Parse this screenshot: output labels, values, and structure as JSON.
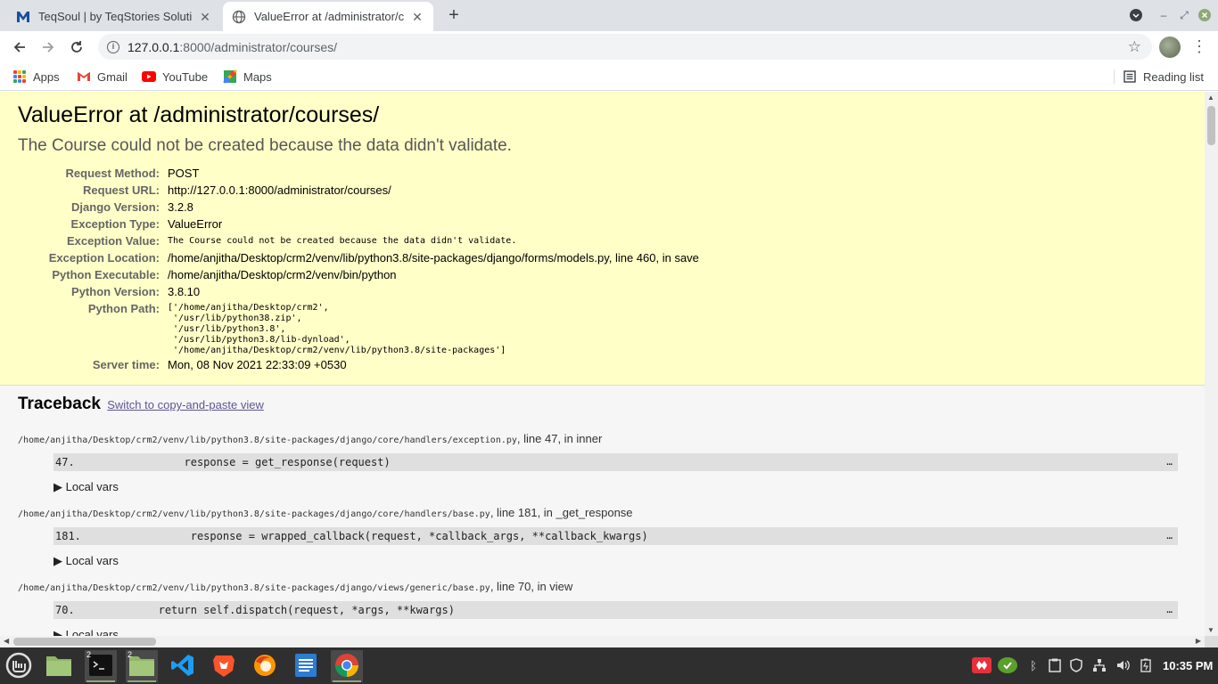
{
  "browser": {
    "tabs": [
      {
        "title": "TeqSoul | by TeqStories Soluti",
        "active": false,
        "favicon": "m-logo-icon"
      },
      {
        "title": "ValueError at /administrator/c",
        "active": true,
        "favicon": "globe-icon"
      }
    ],
    "url_host": "127.0.0.1",
    "url_path": ":8000/administrator/courses/",
    "bookmarks": [
      {
        "label": "Apps",
        "icon": "apps-grid-icon"
      },
      {
        "label": "Gmail",
        "icon": "gmail-icon"
      },
      {
        "label": "YouTube",
        "icon": "youtube-icon"
      },
      {
        "label": "Maps",
        "icon": "maps-icon"
      }
    ],
    "reading_list": "Reading list"
  },
  "error": {
    "title": "ValueError at /administrator/courses/",
    "message": "The Course could not be created because the data didn't validate.",
    "meta": [
      {
        "label": "Request Method:",
        "value": "POST"
      },
      {
        "label": "Request URL:",
        "value": "http://127.0.0.1:8000/administrator/courses/"
      },
      {
        "label": "Django Version:",
        "value": "3.2.8"
      },
      {
        "label": "Exception Type:",
        "value": "ValueError"
      },
      {
        "label": "Exception Value:",
        "value": "The Course could not be created because the data didn't validate."
      },
      {
        "label": "Exception Location:",
        "value": "/home/anjitha/Desktop/crm2/venv/lib/python3.8/site-packages/django/forms/models.py, line 460, in save"
      },
      {
        "label": "Python Executable:",
        "value": "/home/anjitha/Desktop/crm2/venv/bin/python"
      },
      {
        "label": "Python Version:",
        "value": "3.8.10"
      },
      {
        "label": "Python Path:",
        "value": "['/home/anjitha/Desktop/crm2',\n '/usr/lib/python38.zip',\n '/usr/lib/python3.8',\n '/usr/lib/python3.8/lib-dynload',\n '/home/anjitha/Desktop/crm2/venv/lib/python3.8/site-packages']"
      },
      {
        "label": "Server time:",
        "value": "Mon, 08 Nov 2021 22:33:09 +0530"
      }
    ]
  },
  "traceback": {
    "heading": "Traceback",
    "switch_link": "Switch to copy-and-paste view",
    "local_vars_label": "▶ Local vars",
    "frames": [
      {
        "file": "/home/anjitha/Desktop/crm2/venv/lib/python3.8/site-packages/django/core/handlers/exception.py",
        "where": ", line 47, in inner",
        "code": "47.                 response = get_response(request)"
      },
      {
        "file": "/home/anjitha/Desktop/crm2/venv/lib/python3.8/site-packages/django/core/handlers/base.py",
        "where": ", line 181, in _get_response",
        "code": "181.                 response = wrapped_callback(request, *callback_args, **callback_kwargs)"
      },
      {
        "file": "/home/anjitha/Desktop/crm2/venv/lib/python3.8/site-packages/django/views/generic/base.py",
        "where": ", line 70, in view",
        "code": "70.             return self.dispatch(request, *args, **kwargs)"
      }
    ],
    "ellipsis": "…"
  },
  "taskbar": {
    "badge_terminal": "2",
    "badge_files": "2",
    "clock": "10:35 PM"
  },
  "colors": {
    "summary_bg": "#ffffc8",
    "traceback_bg": "#f6f6f6",
    "link": "#5e5694",
    "taskbar": "#2f2f2f"
  }
}
